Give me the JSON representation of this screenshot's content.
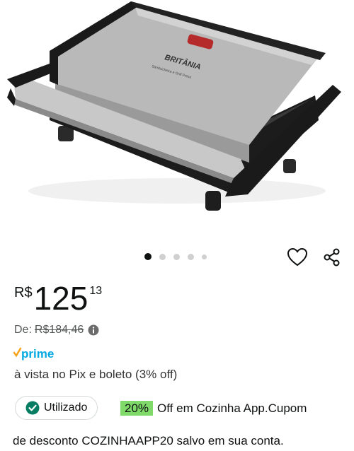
{
  "product": {
    "image_alt": "Britânia Sanduicheira e Grill Press",
    "brand_mark": "BRITÂNIA",
    "model_text": "Sanduicheira e Grill Press"
  },
  "carousel": {
    "count": 5,
    "active_index": 0
  },
  "price": {
    "currency": "R$",
    "whole": "125",
    "cents": "13"
  },
  "was_price": {
    "label": "De:",
    "amount": "R$184,46"
  },
  "prime": {
    "label": "prime"
  },
  "payment_note": "à vista no Pix e boleto (3% off)",
  "coupon": {
    "status_label": "Utilizado",
    "percent": "20%",
    "text_line1": "Off em Cozinha App.Cupom",
    "text_line2": "de desconto COZINHAAPP20 salvo em sua conta."
  },
  "colors": {
    "accent_green": "#7fda69",
    "check_green": "#067d62",
    "prime_blue": "#00a8e1",
    "prime_orange": "#f7a21b"
  }
}
